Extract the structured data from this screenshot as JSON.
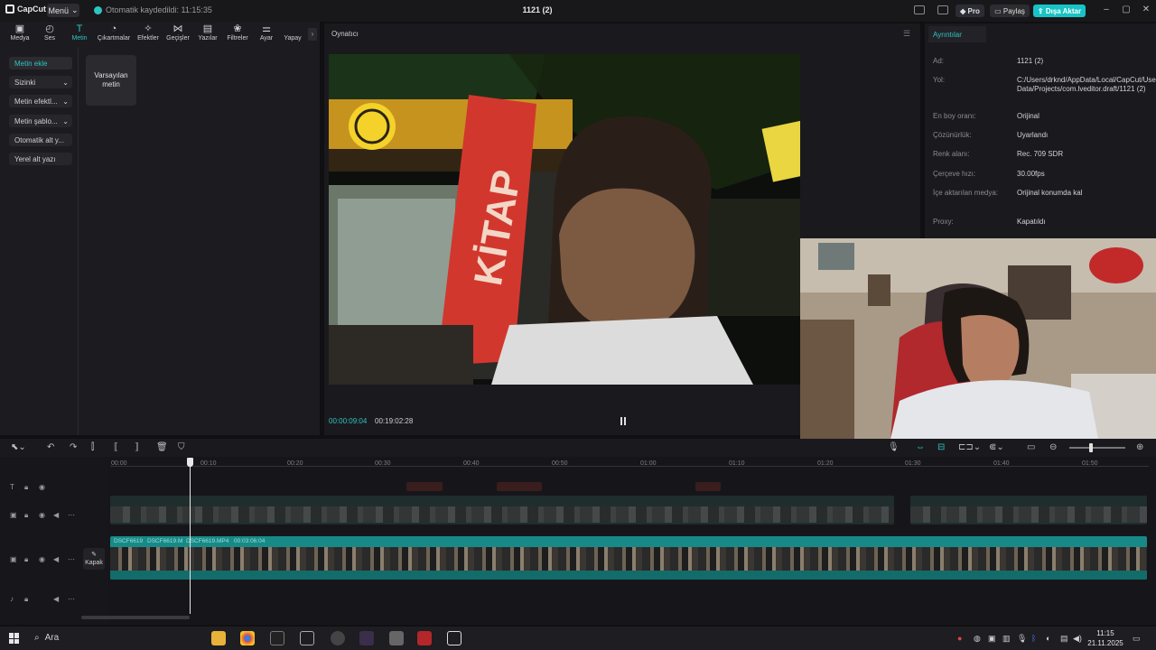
{
  "titlebar": {
    "app_name": "CapCut",
    "menu_label": "Menü",
    "autosave_text": "Otomatik kaydedildi: 11:15:35",
    "project_title": "1121 (2)",
    "pro_label": "Pro",
    "share_label": "Paylaş",
    "export_label": "Dışa Aktar"
  },
  "toolbar": {
    "tools": [
      {
        "label": "Medya",
        "icon": "media-icon"
      },
      {
        "label": "Ses",
        "icon": "audio-icon"
      },
      {
        "label": "Metin",
        "icon": "text-icon"
      },
      {
        "label": "Çıkartmalar",
        "icon": "sticker-icon"
      },
      {
        "label": "Efektler",
        "icon": "effects-icon"
      },
      {
        "label": "Geçişler",
        "icon": "transitions-icon"
      },
      {
        "label": "Yazılar",
        "icon": "captions-icon"
      },
      {
        "label": "Filtreler",
        "icon": "filters-icon"
      },
      {
        "label": "Ayar",
        "icon": "adjust-icon"
      },
      {
        "label": "Yapay",
        "icon": "ai-icon"
      }
    ],
    "active": "Metin"
  },
  "sidebar": {
    "items": [
      {
        "label": "Metin ekle"
      },
      {
        "label": "Sizinki"
      },
      {
        "label": "Metin efektl..."
      },
      {
        "label": "Metin şablo..."
      },
      {
        "label": "Otomatik alt y..."
      },
      {
        "label": "Yerel alt yazı"
      }
    ],
    "card_label": "Varsayılan metin"
  },
  "player": {
    "title": "Oynatıcı",
    "current_time": "00:00:09:04",
    "total_time": "00:19:02:28"
  },
  "details": {
    "tab_label": "Ayrıntılar",
    "rows": [
      {
        "key": "Ad:",
        "value": "1121 (2)"
      },
      {
        "key": "Yol:",
        "value": "C:/Users/drknd/AppData/Local/CapCut/User Data/Projects/com.lveditor.draft/1121 (2)"
      },
      {
        "key": "En boy oranı:",
        "value": "Orijinal"
      },
      {
        "key": "Çözünürlük:",
        "value": "Uyarlandı"
      },
      {
        "key": "Renk alanı:",
        "value": "Rec. 709 SDR"
      },
      {
        "key": "Çerçeve hızı:",
        "value": "30.00fps"
      },
      {
        "key": "İçe aktarılan medya:",
        "value": "Orijinal konumda kal"
      },
      {
        "key": "Proxy:",
        "value": "Kapatıldı"
      }
    ]
  },
  "timeline": {
    "ruler": [
      "00:00",
      "00:10",
      "00:20",
      "00:30",
      "00:40",
      "00:50",
      "01:00",
      "01:10",
      "01:20",
      "01:30",
      "01:40",
      "01:50"
    ],
    "main_clip_labels": [
      "DSCF6619",
      "DSCF6619.M",
      "DSCF6619.MP4",
      "00:03:06:04"
    ],
    "cover_label": "Kapak"
  },
  "taskbar": {
    "search_label": "Ara",
    "time": "11:15",
    "date": "21.11.2025"
  }
}
